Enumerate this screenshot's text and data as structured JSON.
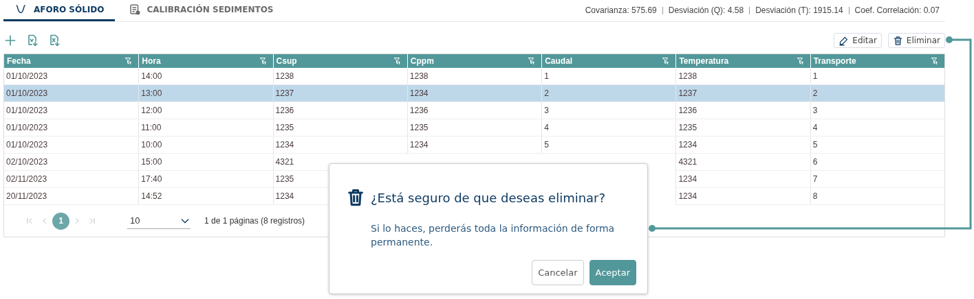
{
  "tabs": [
    {
      "label": "AFORO SÓLIDO",
      "selected": true
    },
    {
      "label": "CALIBRACIÓN SEDIMENTOS",
      "selected": false
    }
  ],
  "stats": [
    {
      "label": "Covarianza:",
      "value": "575.69"
    },
    {
      "label": "Desviación (Q):",
      "value": "4.58"
    },
    {
      "label": "Desviación (T):",
      "value": "1915.14"
    },
    {
      "label": "Coef. Correlación:",
      "value": "0.07"
    }
  ],
  "toolbar": {
    "buttons": [
      {
        "label": "Editar",
        "kind": "edit"
      },
      {
        "label": "Eliminar",
        "kind": "delete"
      }
    ]
  },
  "table": {
    "columns": [
      "Fecha",
      "Hora",
      "Csup",
      "Cppm",
      "Caudal",
      "Temperatura",
      "Transporte"
    ],
    "rows": [
      {
        "selected": false,
        "cells": [
          "01/10/2023",
          "14:00",
          "1238",
          "1238",
          "1",
          "1238",
          "1"
        ]
      },
      {
        "selected": true,
        "cells": [
          "01/10/2023",
          "13:00",
          "1237",
          "1234",
          "2",
          "1237",
          "2"
        ]
      },
      {
        "selected": false,
        "cells": [
          "01/10/2023",
          "12:00",
          "1236",
          "1236",
          "3",
          "1236",
          "3"
        ]
      },
      {
        "selected": false,
        "cells": [
          "01/10/2023",
          "11:00",
          "1235",
          "1235",
          "4",
          "1235",
          "4"
        ]
      },
      {
        "selected": false,
        "cells": [
          "01/10/2023",
          "10:00",
          "1234",
          "1234",
          "5",
          "1234",
          "5"
        ]
      },
      {
        "selected": false,
        "cells": [
          "02/10/2023",
          "15:00",
          "4321",
          null,
          null,
          "4321",
          "6"
        ]
      },
      {
        "selected": false,
        "cells": [
          "02/11/2023",
          "17:40",
          "1235",
          null,
          null,
          "1234",
          "7"
        ]
      },
      {
        "selected": false,
        "cells": [
          "20/11/2023",
          "14:52",
          "1234",
          null,
          null,
          "1234",
          "8"
        ]
      }
    ]
  },
  "pagination": {
    "pages": [
      {
        "label": "1",
        "selected": true
      }
    ],
    "page_size": "10",
    "summary": "1 de 1 páginas (8 registros)"
  },
  "dialog": {
    "title": "¿Está seguro de que deseas eliminar?",
    "message": "Si lo haces, perderás toda la información de forma permanente.",
    "buttons": [
      {
        "label": "Cancelar",
        "kind": "secondary"
      },
      {
        "label": "Aceptar",
        "kind": "primary"
      }
    ]
  }
}
